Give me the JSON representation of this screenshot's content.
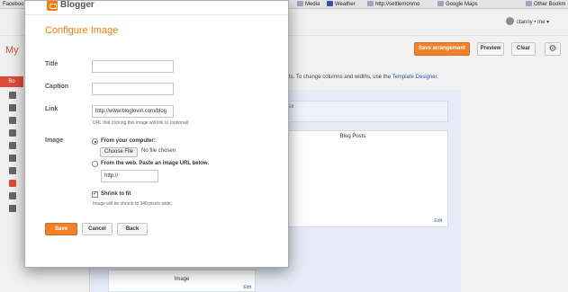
{
  "browser": {
    "bookmarks": [
      "Faceboo",
      "Media",
      "Weather",
      "http://settlemonmo",
      "Google Maps",
      "Other Bookm"
    ]
  },
  "header": {
    "user_label": "ctanny • me ▾"
  },
  "underlay": {
    "page_title": "My",
    "side_button": "Bo",
    "save_arrangement": "Save arrangement",
    "preview": "Preview",
    "clear": "Clear",
    "hint_text": "ts. To change columns and widths, use the ",
    "hint_link": "Template Designer",
    "hint_tail": ".",
    "blog_posts_title": "Blog Posts",
    "image_gadget_title": "Image",
    "edit_link": "Edit",
    "strip_edit": "Ed"
  },
  "dialog": {
    "logo_text": "Blogger",
    "title": "Configure Image",
    "title_label": "Title",
    "title_value": "",
    "caption_label": "Caption",
    "caption_value": "",
    "link_label": "Link",
    "link_value": "http://www.bloglovin.com/blog",
    "link_hint": "URL that clicking this image will link to (optional)",
    "image_label": "Image",
    "from_computer_label": "From your computer:",
    "choose_file": "Choose File",
    "no_file": "No file chosen",
    "from_web_label": "From the web. Paste an image URL below.",
    "url_value": "http://",
    "shrink_label": "Shrink to fit",
    "shrink_hint": "Image will be shrunk to 340 pixels wide.",
    "save": "Save",
    "cancel": "Cancel",
    "back": "Back"
  },
  "colors": {
    "accent": "#f57d00",
    "brand_red": "#dd4b39",
    "link": "#2a5db0"
  }
}
